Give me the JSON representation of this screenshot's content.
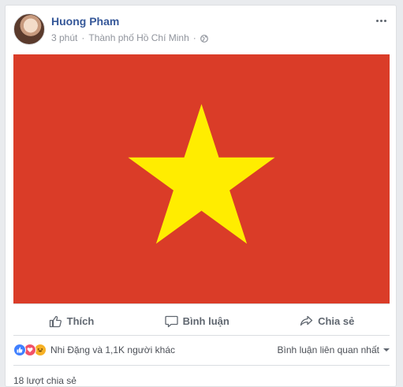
{
  "post": {
    "author": "Huong Pham",
    "time": "3 phút",
    "separator": "·",
    "location": "Thành phố Hồ Chí Minh",
    "privacy_icon": "globe-icon",
    "more_icon": "more-options-icon"
  },
  "image": {
    "description_icon": "vietnam-flag",
    "background_color": "#da3c28",
    "star_color": "#ffed00"
  },
  "actions": [
    {
      "label": "Thích",
      "icon": "like-icon"
    },
    {
      "label": "Bình luận",
      "icon": "comment-icon"
    },
    {
      "label": "Chia sẻ",
      "icon": "share-icon"
    }
  ],
  "reactions": {
    "icons": [
      "like-reaction-icon",
      "love-reaction-icon",
      "haha-reaction-icon"
    ],
    "summary": "Nhi Đặng và 1,1K người khác"
  },
  "comments": {
    "sort_label": "Bình luận liên quan nhất"
  },
  "shares": {
    "label": "18 lượt chia sẻ"
  },
  "colors": {
    "link": "#365899",
    "muted": "#90949c",
    "like": "#4080ff",
    "love": "#f25268",
    "haha": "#f7b125"
  }
}
